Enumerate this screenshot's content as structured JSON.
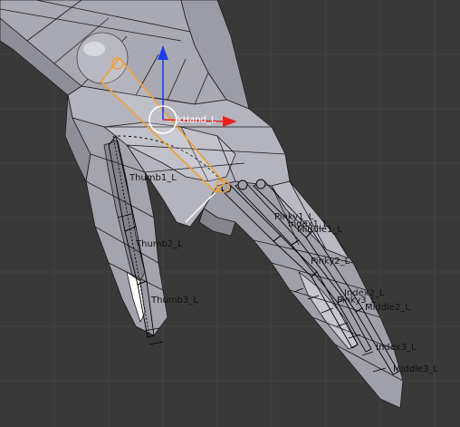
{
  "viewport": {
    "background": "#393939",
    "grid_color": "#444444",
    "mesh_fill": "#a7a7b2",
    "mesh_shadow": "#7f7f89",
    "wire_color": "#1a1a1a",
    "selection_color": "#f0a030",
    "gizmo": {
      "x_axis_color": "#e8231f",
      "z_axis_color": "#1a3cf0",
      "center_color": "#ffffff"
    }
  },
  "active_bone": {
    "label": "ikHand_L"
  },
  "bone_labels": {
    "thumb1": "Thumb1_L",
    "thumb2": "Thumb2_L",
    "thumb3": "Thumb3_L",
    "pinky1": "Pinky1_L",
    "index1": "Index1_L",
    "middle1": "Middle1_L",
    "pinky2": "Pinky2_L",
    "index2": "Index2_L",
    "middle2": "Middle2_L",
    "pinky3": "Pinky3_L",
    "index3": "Index3_L",
    "middle3": "Middle3_L"
  }
}
